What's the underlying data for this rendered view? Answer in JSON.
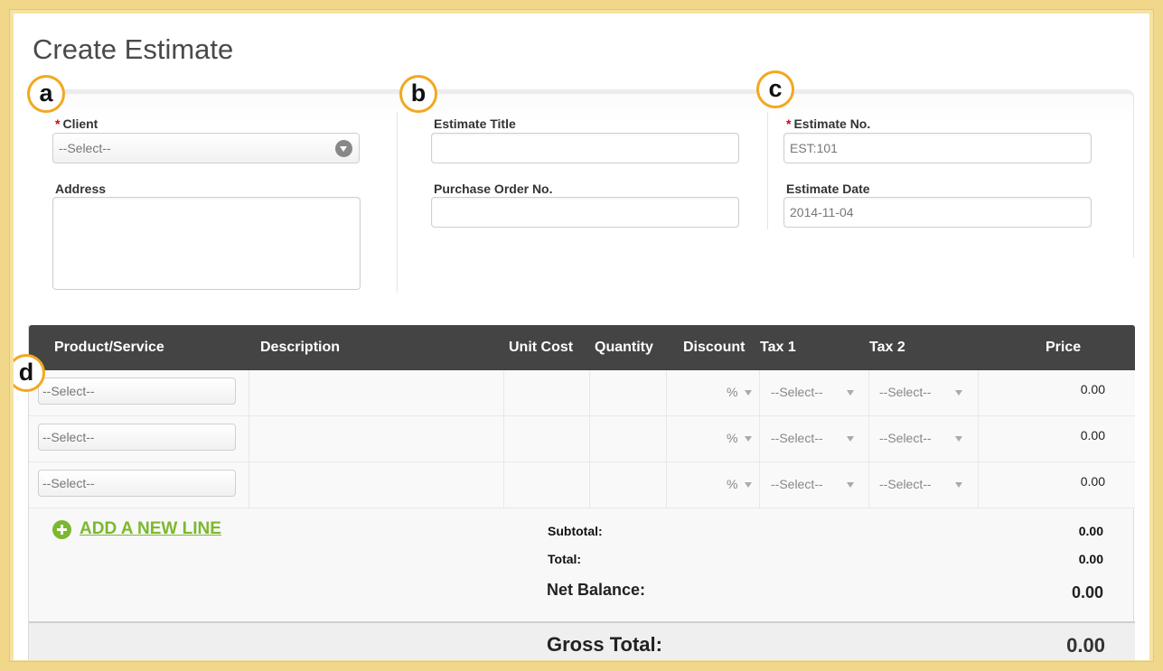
{
  "page": {
    "title": "Create Estimate"
  },
  "badges": {
    "a": "a",
    "b": "b",
    "c": "c",
    "d": "d"
  },
  "client": {
    "label": "Client",
    "select_value": "--Select--",
    "address_label": "Address",
    "address_value": ""
  },
  "estimate_info": {
    "title_label": "Estimate Title",
    "title_value": "",
    "po_label": "Purchase Order No.",
    "po_value": ""
  },
  "estimate_meta": {
    "number_label": "Estimate No.",
    "number_value": "EST:101",
    "date_label": "Estimate Date",
    "date_value": "2014-11-04"
  },
  "table": {
    "columns": {
      "product": "Product/Service",
      "description": "Description",
      "unit_cost": "Unit Cost",
      "quantity": "Quantity",
      "discount": "Discount",
      "tax1": "Tax 1",
      "tax2": "Tax 2",
      "price": "Price"
    },
    "rows": [
      {
        "product": "--Select--",
        "discount_unit": "%",
        "tax1": "--Select--",
        "tax2": "--Select--",
        "price": "0.00"
      },
      {
        "product": "--Select--",
        "discount_unit": "%",
        "tax1": "--Select--",
        "tax2": "--Select--",
        "price": "0.00"
      },
      {
        "product": "--Select--",
        "discount_unit": "%",
        "tax1": "--Select--",
        "tax2": "--Select--",
        "price": "0.00"
      }
    ]
  },
  "actions": {
    "add_line": "ADD A NEW LINE"
  },
  "summary": {
    "subtotal_label": "Subtotal:",
    "subtotal_value": "0.00",
    "total_label": "Total:",
    "total_value": "0.00",
    "net_balance_label": "Net Balance:",
    "net_balance_value": "0.00",
    "gross_total_label": "Gross Total:",
    "gross_total_value": "0.00"
  },
  "colors": {
    "frame": "#f0d78a",
    "badge_ring": "#f2a81e",
    "header_bg": "#444444",
    "accent_green": "#7cb82f",
    "required": "#d0021b"
  }
}
